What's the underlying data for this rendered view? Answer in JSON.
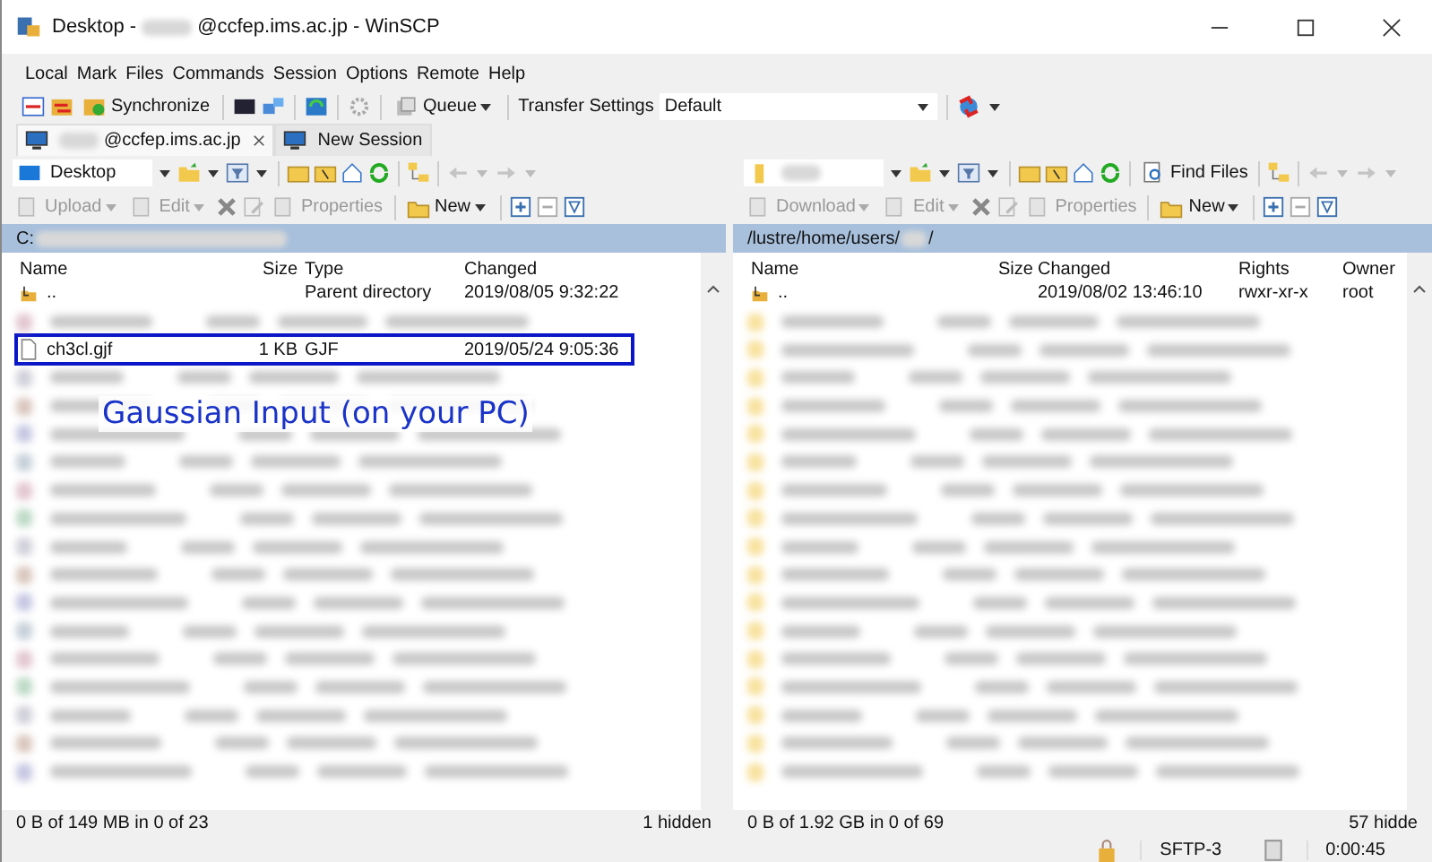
{
  "window": {
    "title_parts": [
      "Desktop -",
      "@ccfep.ims.ac.jp - WinSCP"
    ]
  },
  "menu": [
    "Local",
    "Mark",
    "Files",
    "Commands",
    "Session",
    "Options",
    "Remote",
    "Help"
  ],
  "toolbar": {
    "synchronize": "Synchronize",
    "queue": "Queue",
    "transfer_label": "Transfer Settings",
    "transfer_value": "Default"
  },
  "session_tabs": [
    {
      "label": "@ccfep.ims.ac.jp",
      "selected": true
    },
    {
      "label": "New Session",
      "selected": false
    }
  ],
  "left_panel": {
    "location": {
      "kind": "desktop",
      "label": "Desktop"
    },
    "actions": [
      {
        "label": "Upload",
        "disabled": true
      },
      {
        "label": "Edit",
        "disabled": true
      },
      {
        "label": "Properties",
        "disabled": true
      },
      {
        "label": "New",
        "disabled": false
      }
    ],
    "path": "C:",
    "columns": [
      "Name",
      "Size",
      "Type",
      "Changed"
    ],
    "annotation": "Gaussian Input (on your PC)",
    "rows": [
      {
        "kind": "parent",
        "highlighted": false,
        "cells": [
          "..",
          "",
          "Parent directory",
          "2019/08/05  9:32:22"
        ]
      },
      {
        "kind": "redacted",
        "highlighted": false
      },
      {
        "kind": "file",
        "highlighted": true,
        "cells": [
          "ch3cl.gjf",
          "1 KB",
          "GJF",
          "2019/05/24  9:05:36"
        ]
      },
      {
        "kind": "redacted",
        "highlighted": false
      },
      {
        "kind": "redacted",
        "highlighted": false
      },
      {
        "kind": "redacted",
        "highlighted": false
      },
      {
        "kind": "redacted",
        "highlighted": false
      },
      {
        "kind": "redacted",
        "highlighted": false
      },
      {
        "kind": "redacted",
        "highlighted": false
      },
      {
        "kind": "redacted",
        "highlighted": false
      },
      {
        "kind": "redacted",
        "highlighted": false
      },
      {
        "kind": "redacted",
        "highlighted": false
      },
      {
        "kind": "redacted",
        "highlighted": false
      },
      {
        "kind": "redacted",
        "highlighted": false
      },
      {
        "kind": "redacted",
        "highlighted": false
      },
      {
        "kind": "redacted",
        "highlighted": false
      },
      {
        "kind": "redacted",
        "highlighted": false
      },
      {
        "kind": "redacted",
        "highlighted": false
      }
    ],
    "status": [
      "0 B of 149 MB in 0 of 23",
      "1 hidden"
    ]
  },
  "right_panel": {
    "location": {
      "kind": "folder"
    },
    "find_files": "Find Files",
    "actions": [
      {
        "label": "Download",
        "disabled": true
      },
      {
        "label": "Edit",
        "disabled": true
      },
      {
        "label": "Properties",
        "disabled": true
      },
      {
        "label": "New",
        "disabled": false
      }
    ],
    "path": "/lustre/home/users/",
    "path_suffix": "/",
    "columns": [
      "Name",
      "Size",
      "Changed",
      "Rights",
      "Owner"
    ],
    "rows": [
      {
        "kind": "parent",
        "highlighted": false,
        "cells": [
          "..",
          "",
          "2019/08/02 13:46:10",
          "rwxr-xr-x",
          "root"
        ]
      },
      {
        "kind": "redacted_folder",
        "highlighted": false
      },
      {
        "kind": "redacted_folder",
        "highlighted": false
      },
      {
        "kind": "redacted_folder",
        "highlighted": false
      },
      {
        "kind": "redacted_folder",
        "highlighted": false
      },
      {
        "kind": "redacted_folder",
        "highlighted": false
      },
      {
        "kind": "redacted_folder",
        "highlighted": false
      },
      {
        "kind": "redacted_folder",
        "highlighted": false
      },
      {
        "kind": "redacted_folder",
        "highlighted": false
      },
      {
        "kind": "redacted_folder",
        "highlighted": false
      },
      {
        "kind": "redacted_folder",
        "highlighted": false
      },
      {
        "kind": "redacted_folder",
        "highlighted": false
      },
      {
        "kind": "redacted_folder",
        "highlighted": false
      },
      {
        "kind": "redacted_folder",
        "highlighted": false
      },
      {
        "kind": "redacted_folder",
        "highlighted": false
      },
      {
        "kind": "redacted_folder",
        "highlighted": false
      },
      {
        "kind": "redacted_folder",
        "highlighted": false
      },
      {
        "kind": "redacted_folder",
        "highlighted": false
      }
    ],
    "status": [
      "0 B of 1.92 GB in 0 of 69",
      "57 hidde"
    ]
  },
  "bottom_status": {
    "protocol": "SFTP-3",
    "time": "0:00:45"
  }
}
